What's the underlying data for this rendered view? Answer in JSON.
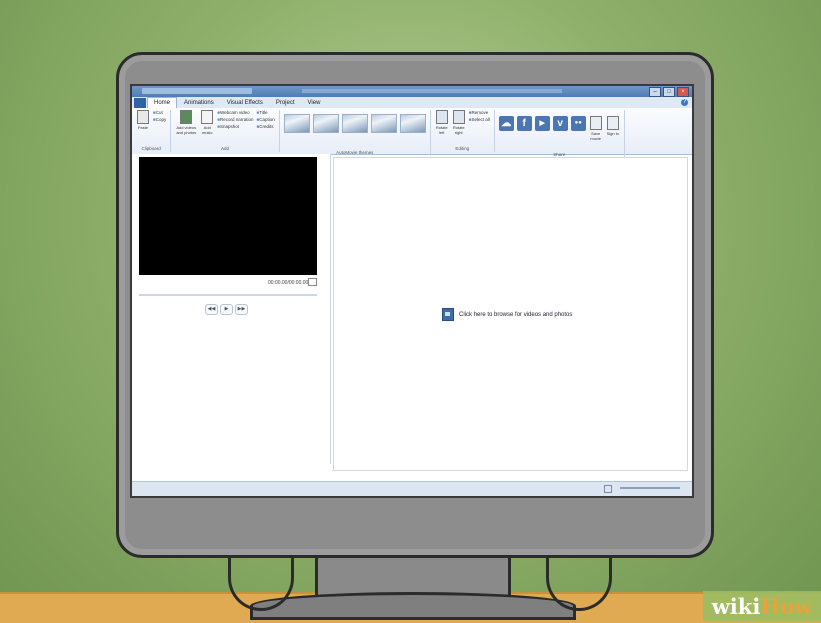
{
  "tabs": {
    "file": "",
    "home": "Home",
    "animations": "Animations",
    "visual_effects": "Visual Effects",
    "project": "Project",
    "view": "View"
  },
  "ribbon": {
    "clipboard": {
      "label": "Clipboard",
      "paste": "Paste",
      "cut": "Cut",
      "copy": "Copy"
    },
    "add": {
      "label": "Add",
      "add_videos": "Add videos and photos",
      "add_music": "Add music",
      "webcam": "Webcam video",
      "narration": "Record narration",
      "snapshot": "Snapshot",
      "title": "Title",
      "caption": "Caption",
      "credits": "Credits"
    },
    "themes": {
      "label": "AutoMovie themes"
    },
    "editing": {
      "label": "Editing",
      "rotate_left": "Rotate left",
      "rotate_right": "Rotate right",
      "remove": "Remove",
      "select_all": "Select all"
    },
    "share": {
      "label": "Share",
      "tiles": [
        "☁",
        "f",
        "▶",
        "v",
        "●●"
      ],
      "save_movie": "Save movie",
      "sign_in": "Sign in"
    }
  },
  "preview": {
    "timecode": "00:00.00/00:00.00"
  },
  "storyboard": {
    "browse_text": "Click here to browse for videos and photos"
  },
  "watermark": {
    "wiki": "wiki",
    "how": "How"
  },
  "colors": {
    "accent": "#2d64a8",
    "wall": "#8fb06b",
    "desk": "#e0aa52"
  }
}
